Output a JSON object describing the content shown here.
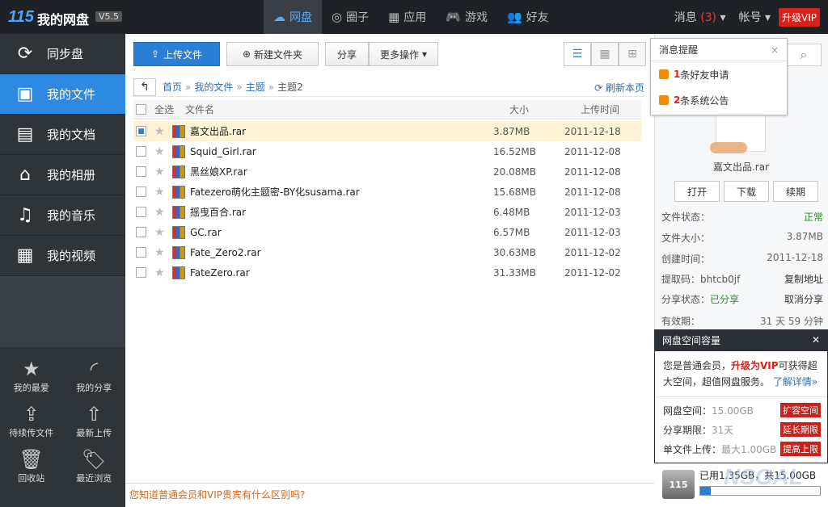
{
  "topbar": {
    "logo": "115",
    "title": "我的网盘",
    "version": "V5.5",
    "nav": [
      {
        "label": "网盘",
        "icon": "☁"
      },
      {
        "label": "圈子",
        "icon": "◎"
      },
      {
        "label": "应用",
        "icon": "▦"
      },
      {
        "label": "游戏",
        "icon": "🎮"
      },
      {
        "label": "好友",
        "icon": "👥"
      }
    ],
    "message_label": "消息",
    "message_count": "(3)",
    "account_label": "帐号",
    "vip_label": "升级VIP"
  },
  "sidebar": {
    "items": [
      {
        "label": "同步盘",
        "icon": "⟳"
      },
      {
        "label": "我的文件",
        "icon": "▣"
      },
      {
        "label": "我的文档",
        "icon": "▤"
      },
      {
        "label": "我的相册",
        "icon": "⌂"
      },
      {
        "label": "我的音乐",
        "icon": "♫"
      },
      {
        "label": "我的视频",
        "icon": "▦"
      }
    ],
    "tools": [
      {
        "label": "我的最爱",
        "icon": "★"
      },
      {
        "label": "我的分享",
        "icon": "◜"
      },
      {
        "label": "待续传文件",
        "icon": "⇪"
      },
      {
        "label": "最新上传",
        "icon": "⇧"
      },
      {
        "label": "回收站",
        "icon": "🗑"
      },
      {
        "label": "最近浏览",
        "icon": "🏷"
      }
    ]
  },
  "toolbar": {
    "upload": "上传文件",
    "new_folder": "新建文件夹",
    "share": "分享",
    "more": "更多操作"
  },
  "breadcrumb": {
    "items": [
      "首页",
      "我的文件",
      "主题",
      "主题2"
    ],
    "refresh": "刷新本页"
  },
  "table": {
    "select_all": "全选",
    "col_name": "文件名",
    "col_size": "大小",
    "col_date": "上传时间",
    "rows": [
      {
        "name": "嘉文出品.rar",
        "size": "3.87MB",
        "date": "2011-12-18"
      },
      {
        "name": "Squid_Girl.rar",
        "size": "16.52MB",
        "date": "2011-12-08"
      },
      {
        "name": "黑丝娘XP.rar",
        "size": "20.08MB",
        "date": "2011-12-08"
      },
      {
        "name": "Fatezero萌化主题密-BY化susama.rar",
        "size": "15.68MB",
        "date": "2011-12-08"
      },
      {
        "name": "摇曳百合.rar",
        "size": "6.48MB",
        "date": "2011-12-03"
      },
      {
        "name": "GC.rar",
        "size": "6.57MB",
        "date": "2011-12-03"
      },
      {
        "name": "Fate_Zero2.rar",
        "size": "30.63MB",
        "date": "2011-12-02"
      },
      {
        "name": "FateZero.rar",
        "size": "31.33MB",
        "date": "2011-12-02"
      }
    ]
  },
  "hint": "您知道普通会员和VIP贵宾有什么区别吗?",
  "popup": {
    "title": "消息提醒",
    "item1_num": "1",
    "item1_text": "条好友申请",
    "item2_num": "2",
    "item2_text": "条系统公告"
  },
  "detail": {
    "filename": "嘉文出品.rar",
    "open": "打开",
    "download": "下载",
    "renew": "续期",
    "status_label": "文件状态：",
    "status": "正常",
    "size_label": "文件大小：",
    "size": "3.87MB",
    "created_label": "创建时间：",
    "created": "2011-12-18",
    "code_label": "提取码：bhtcb0jf",
    "copy": "复制地址",
    "share_label": "分享状态：",
    "share_status": "已分享",
    "cancel_share": "取消分享",
    "expiry_label": "有效期：",
    "expiry": "31 天  59 分钟"
  },
  "capacity": {
    "title": "网盘空间容量",
    "desc1": "您是普通会员，",
    "desc_vip": "升级为VIP",
    "desc2": "可获得超大空间，超值网盘服务。",
    "learn": "了解详情»",
    "space_label": "网盘空间：",
    "space": "15.00GB",
    "space_btn": "扩容空间",
    "share_label": "分享期限：",
    "share": "31天",
    "share_btn": "延长期限",
    "single_label": "单文件上传：",
    "single": "最大1.00GB",
    "single_btn": "提高上限",
    "usage": "已用1.35GB，共15.00GB",
    "usage_fraction": 0.09,
    "drive_label": "115"
  }
}
